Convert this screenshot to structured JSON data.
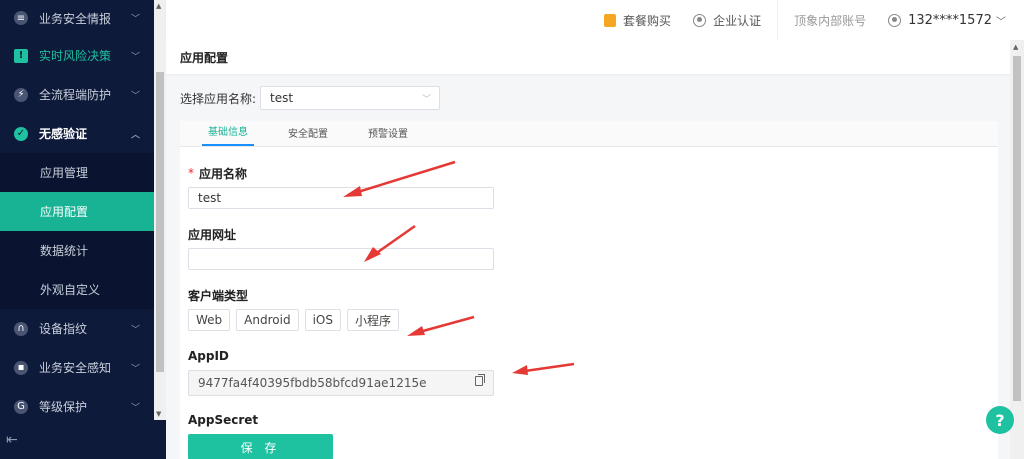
{
  "sidebar": {
    "items": [
      {
        "label": "业务安全情报",
        "icon": "list-icon"
      },
      {
        "label": "实时风险决策",
        "icon": "alert-icon"
      },
      {
        "label": "全流程端防护",
        "icon": "shield-icon"
      },
      {
        "label": "无感验证",
        "icon": "check-icon"
      }
    ],
    "sub_items": [
      {
        "label": "应用管理"
      },
      {
        "label": "应用配置"
      },
      {
        "label": "数据统计"
      },
      {
        "label": "外观自定义"
      }
    ],
    "items_after": [
      {
        "label": "设备指纹",
        "icon": "fingerprint-icon"
      },
      {
        "label": "业务安全感知",
        "icon": "monitor-icon"
      },
      {
        "label": "等级保护",
        "icon": "g-icon"
      }
    ],
    "footer_icon": "menu-collapse-icon"
  },
  "header": {
    "package": "套餐购买",
    "cert": "企业认证",
    "account_label": "顶象内部账号",
    "phone": "132****1572"
  },
  "page": {
    "title": "应用配置",
    "select_label": "选择应用名称:",
    "select_value": "test"
  },
  "tabs": [
    {
      "label": "基础信息"
    },
    {
      "label": "安全配置"
    },
    {
      "label": "预警设置"
    }
  ],
  "form": {
    "app_name_label": "应用名称",
    "app_name_required": "*",
    "app_name_value": "test",
    "app_url_label": "应用网址",
    "app_url_value": "",
    "client_type_label": "客户端类型",
    "client_types": [
      "Web",
      "Android",
      "iOS",
      "小程序"
    ],
    "appid_label": "AppID",
    "appid_value": "9477fa4f40395fbdb58bfcd91ae1215e",
    "appsecret_label": "AppSecret",
    "save_label": "保 存"
  },
  "help": {
    "label": "?"
  },
  "colors": {
    "accent": "#1ec2a0",
    "sidebar_bg": "#0e1a3a",
    "arrow": "#e53935"
  }
}
